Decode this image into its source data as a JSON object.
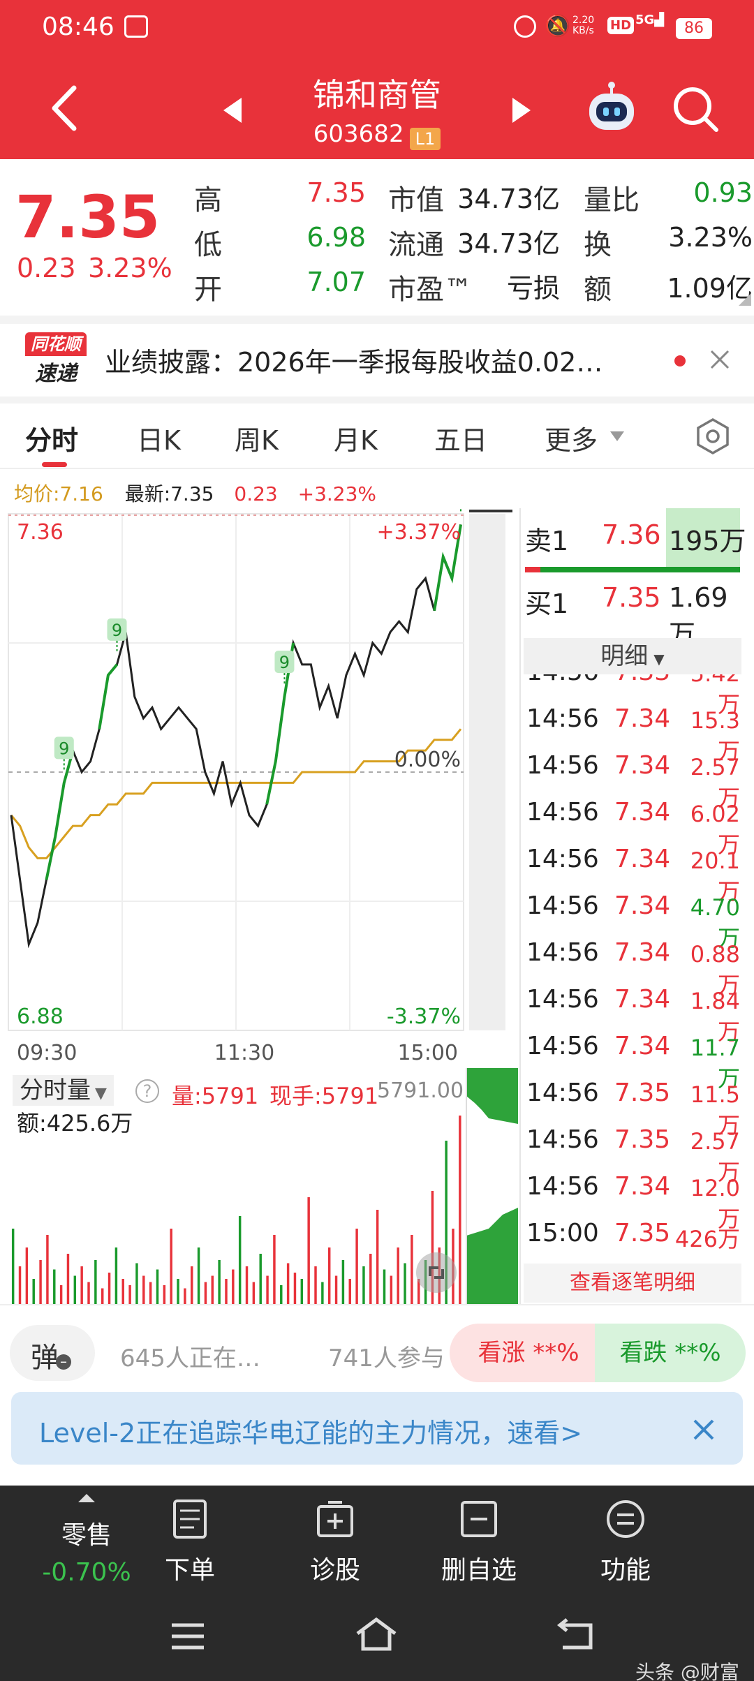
{
  "status": {
    "time": "08:46",
    "net_speed": "2.20\nKB/s",
    "battery": "86"
  },
  "header": {
    "title": "锦和商管",
    "code": "603682",
    "level": "L1"
  },
  "quote": {
    "price": "7.35",
    "change": "0.23",
    "change_pct": "3.23%",
    "rows": [
      {
        "l1": "高",
        "v1": "7.35",
        "l2": "市值",
        "v2": "34.73亿",
        "l3": "量比",
        "v3": "0.93"
      },
      {
        "l1": "低",
        "v1": "6.98",
        "l2": "流通",
        "v2": "34.73亿",
        "l3": "换",
        "v3": "3.23%"
      },
      {
        "l1": "开",
        "v1": "7.07",
        "l2": "市盈™",
        "v2": "亏损",
        "l3": "额",
        "v3": "1.09亿"
      }
    ]
  },
  "news": {
    "logo_top": "同花顺",
    "logo_bottom": "速递",
    "text": "业绩披露：2026年一季报每股收益0.02…"
  },
  "tabs": [
    "分时",
    "日K",
    "周K",
    "月K",
    "五日",
    "更多"
  ],
  "chart_info": {
    "avg": "均价:7.16",
    "latest": "最新:7.35",
    "chg": "0.23",
    "pct": "+3.23%"
  },
  "chart_data": {
    "type": "line",
    "title": "",
    "y_labels": {
      "top": "7.36",
      "bottom": "6.88",
      "top_pct": "+3.37%",
      "mid_pct": "0.00%",
      "bottom_pct": "-3.37%"
    },
    "x_labels": [
      "09:30",
      "11:30",
      "15:00"
    ],
    "ylim": [
      6.88,
      7.36
    ],
    "prev_close": 7.12,
    "series": [
      {
        "name": "最新",
        "values": [
          7.08,
          7.02,
          6.96,
          6.98,
          7.02,
          7.06,
          7.11,
          7.14,
          7.12,
          7.13,
          7.16,
          7.21,
          7.22,
          7.25,
          7.19,
          7.17,
          7.18,
          7.16,
          7.17,
          7.18,
          7.17,
          7.16,
          7.12,
          7.1,
          7.13,
          7.09,
          7.11,
          7.08,
          7.07,
          7.09,
          7.13,
          7.19,
          7.24,
          7.22,
          7.22,
          7.18,
          7.2,
          7.17,
          7.21,
          7.23,
          7.21,
          7.24,
          7.23,
          7.25,
          7.26,
          7.25,
          7.29,
          7.3,
          7.27,
          7.32,
          7.3,
          7.35
        ]
      },
      {
        "name": "均价",
        "values": [
          7.08,
          7.07,
          7.05,
          7.04,
          7.04,
          7.05,
          7.06,
          7.07,
          7.07,
          7.08,
          7.08,
          7.09,
          7.09,
          7.1,
          7.1,
          7.1,
          7.11,
          7.11,
          7.11,
          7.11,
          7.11,
          7.11,
          7.11,
          7.11,
          7.11,
          7.11,
          7.11,
          7.11,
          7.11,
          7.11,
          7.11,
          7.11,
          7.11,
          7.12,
          7.12,
          7.12,
          7.12,
          7.12,
          7.12,
          7.12,
          7.13,
          7.13,
          7.13,
          7.13,
          7.13,
          7.14,
          7.14,
          7.14,
          7.15,
          7.15,
          7.15,
          7.16
        ]
      }
    ],
    "markers": [
      "9",
      "9",
      "9",
      "9"
    ]
  },
  "orderbook": {
    "sell": {
      "label": "卖1",
      "price": "7.36",
      "vol": "195万"
    },
    "buy": {
      "label": "买1",
      "price": "7.35",
      "vol": "1.69万"
    },
    "detail_label": "明细",
    "partial": {
      "time": "14:56",
      "price": "7.33",
      "vol": "5.42万"
    },
    "trades": [
      {
        "time": "14:56",
        "price": "7.34",
        "vol": "15.3万",
        "c": "red"
      },
      {
        "time": "14:56",
        "price": "7.34",
        "vol": "2.57万",
        "c": "red"
      },
      {
        "time": "14:56",
        "price": "7.34",
        "vol": "6.02万",
        "c": "red"
      },
      {
        "time": "14:56",
        "price": "7.34",
        "vol": "20.1万",
        "c": "red"
      },
      {
        "time": "14:56",
        "price": "7.34",
        "vol": "4.70万",
        "c": "green"
      },
      {
        "time": "14:56",
        "price": "7.34",
        "vol": "0.88万",
        "c": "red"
      },
      {
        "time": "14:56",
        "price": "7.34",
        "vol": "1.84万",
        "c": "red"
      },
      {
        "time": "14:56",
        "price": "7.34",
        "vol": "11.7万",
        "c": "green"
      },
      {
        "time": "14:56",
        "price": "7.35",
        "vol": "11.5万",
        "c": "red"
      },
      {
        "time": "14:56",
        "price": "7.35",
        "vol": "2.57万",
        "c": "red"
      },
      {
        "time": "14:56",
        "price": "7.34",
        "vol": "12.0万",
        "c": "red"
      },
      {
        "time": "15:00",
        "price": "7.35",
        "vol": "426万",
        "c": "red"
      }
    ],
    "view_all": "查看逐笔明细"
  },
  "volume": {
    "selector": "分时量",
    "vol": "量:5791",
    "now": "现手:5791",
    "max": "5791.00",
    "amount": "额:425.6万"
  },
  "sentiment": {
    "danmu": "弹",
    "watching": "645人正在…",
    "participants": "741人参与",
    "up": "看涨 **%",
    "down": "看跌 **%"
  },
  "banner": {
    "text": "Level-2正在追踪华电辽能的主力情况，速看>"
  },
  "bottom_nav": {
    "index_name": "零售",
    "index_change": "-0.70%",
    "items": [
      "下单",
      "诊股",
      "删自选",
      "功能"
    ]
  },
  "watermark": "头条 @财富"
}
